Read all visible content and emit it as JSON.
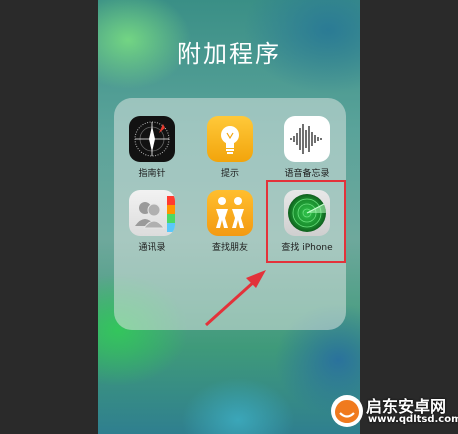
{
  "folder": {
    "title": "附加程序",
    "apps": [
      {
        "label": "指南针",
        "icon": "compass-icon"
      },
      {
        "label": "提示",
        "icon": "tips-lightbulb-icon"
      },
      {
        "label": "语音备忘录",
        "icon": "voice-memo-waveform-icon"
      },
      {
        "label": "通讯录",
        "icon": "contacts-icon"
      },
      {
        "label": "查找朋友",
        "icon": "find-friends-icon"
      },
      {
        "label": "查找 iPhone",
        "icon": "find-iphone-radar-icon"
      }
    ]
  },
  "annotation": {
    "highlight_color": "#e3323a",
    "arrow_color": "#e3323a"
  },
  "watermark": {
    "title": "启东安卓网",
    "url": "www.qdltsd.com"
  }
}
